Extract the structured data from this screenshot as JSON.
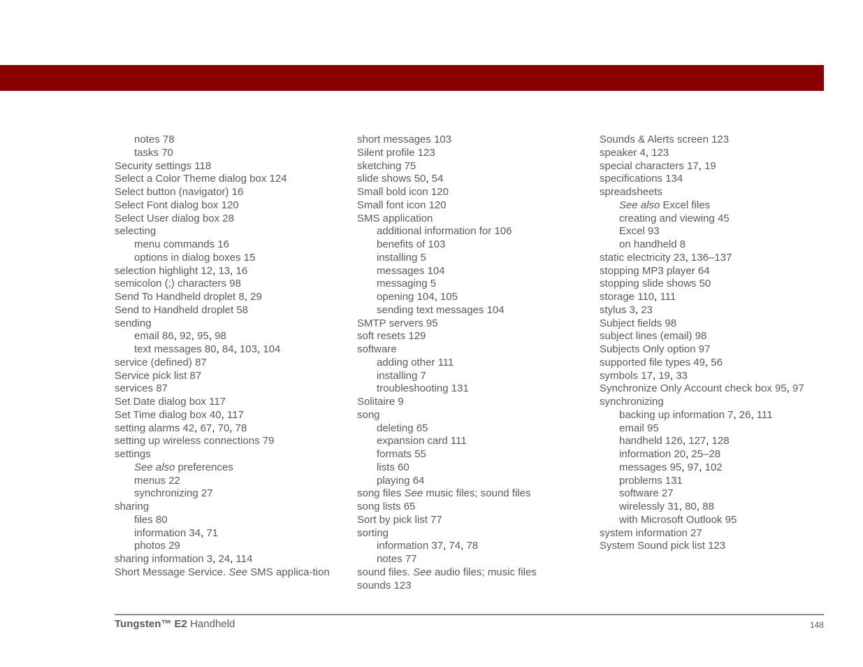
{
  "header": {
    "bar_color": "#8a0000"
  },
  "columns": [
    {
      "entries": [
        {
          "level": 1,
          "term": "notes",
          "pages": [
            "78"
          ]
        },
        {
          "level": 1,
          "term": "tasks",
          "pages": [
            "70"
          ]
        },
        {
          "level": 0,
          "term": "Security settings",
          "pages": [
            "118"
          ]
        },
        {
          "level": 0,
          "term": "Select a Color Theme dialog box",
          "pages": [
            "124"
          ]
        },
        {
          "level": 0,
          "term": "Select button (navigator)",
          "pages": [
            "16"
          ]
        },
        {
          "level": 0,
          "term": "Select Font dialog box",
          "pages": [
            "120"
          ]
        },
        {
          "level": 0,
          "term": "Select User dialog box",
          "pages": [
            "28"
          ]
        },
        {
          "level": 0,
          "term": "selecting",
          "pages": []
        },
        {
          "level": 1,
          "term": "menu commands",
          "pages": [
            "16"
          ]
        },
        {
          "level": 1,
          "term": "options in dialog boxes",
          "pages": [
            "15"
          ]
        },
        {
          "level": 0,
          "term": "selection highlight",
          "pages": [
            "12",
            "13",
            "16"
          ]
        },
        {
          "level": 0,
          "term": "semicolon (;) characters",
          "pages": [
            "98"
          ]
        },
        {
          "level": 0,
          "term": "Send To Handheld droplet",
          "pages": [
            "8",
            "29"
          ]
        },
        {
          "level": 0,
          "term": "Send to Handheld droplet",
          "pages": [
            "58"
          ]
        },
        {
          "level": 0,
          "term": "sending",
          "pages": []
        },
        {
          "level": 1,
          "term": "email",
          "pages": [
            "86",
            "92",
            "95",
            "98"
          ]
        },
        {
          "level": 1,
          "term": "text messages",
          "pages": [
            "80",
            "84",
            "103",
            "104"
          ]
        },
        {
          "level": 0,
          "term": "service (defined)",
          "pages": [
            "87"
          ]
        },
        {
          "level": 0,
          "term": "Service pick list",
          "pages": [
            "87"
          ]
        },
        {
          "level": 0,
          "term": "services",
          "pages": [
            "87"
          ]
        },
        {
          "level": 0,
          "term": "Set Date dialog box",
          "pages": [
            "117"
          ]
        },
        {
          "level": 0,
          "term": "Set Time dialog box",
          "pages": [
            "40",
            "117"
          ]
        },
        {
          "level": 0,
          "term": "setting alarms",
          "pages": [
            "42",
            "67",
            "70",
            "78"
          ]
        },
        {
          "level": 0,
          "term": "setting up wireless connections",
          "pages": [
            "79"
          ]
        },
        {
          "level": 0,
          "term": "settings",
          "pages": []
        },
        {
          "level": 1,
          "see_prefix": "See also",
          "term": "preferences",
          "pages": []
        },
        {
          "level": 1,
          "term": "menus",
          "pages": [
            "22"
          ]
        },
        {
          "level": 1,
          "term": "synchronizing",
          "pages": [
            "27"
          ]
        },
        {
          "level": 0,
          "term": "sharing",
          "pages": []
        },
        {
          "level": 1,
          "term": "files",
          "pages": [
            "80"
          ]
        },
        {
          "level": 1,
          "term": "information",
          "pages": [
            "34",
            "71"
          ]
        },
        {
          "level": 1,
          "term": "photos",
          "pages": [
            "29"
          ]
        },
        {
          "level": 0,
          "term": "sharing information",
          "pages": [
            "3",
            "24",
            "114"
          ]
        },
        {
          "level": 0,
          "term": "Short Message Service.",
          "see_infix": "See",
          "see_target": "SMS applica-tion",
          "wrap": true,
          "pages": []
        }
      ]
    },
    {
      "entries": [
        {
          "level": 0,
          "term": "short messages",
          "pages": [
            "103"
          ]
        },
        {
          "level": 0,
          "term": "Silent profile",
          "pages": [
            "123"
          ]
        },
        {
          "level": 0,
          "term": "sketching",
          "pages": [
            "75"
          ]
        },
        {
          "level": 0,
          "term": "slide shows",
          "pages": [
            "50",
            "54"
          ]
        },
        {
          "level": 0,
          "term": "Small bold icon",
          "pages": [
            "120"
          ]
        },
        {
          "level": 0,
          "term": "Small font icon",
          "pages": [
            "120"
          ]
        },
        {
          "level": 0,
          "term": "SMS application",
          "pages": []
        },
        {
          "level": 1,
          "term": "additional information for",
          "pages": [
            "106"
          ]
        },
        {
          "level": 1,
          "term": "benefits of",
          "pages": [
            "103"
          ]
        },
        {
          "level": 1,
          "term": "installing",
          "pages": [
            "5"
          ]
        },
        {
          "level": 1,
          "term": "messages",
          "pages": [
            "104"
          ]
        },
        {
          "level": 1,
          "term": "messaging",
          "pages": [
            "5"
          ]
        },
        {
          "level": 1,
          "term": "opening",
          "pages": [
            "104",
            "105"
          ]
        },
        {
          "level": 1,
          "term": "sending text messages",
          "pages": [
            "104"
          ]
        },
        {
          "level": 0,
          "term": "SMTP servers",
          "pages": [
            "95"
          ]
        },
        {
          "level": 0,
          "term": "soft resets",
          "pages": [
            "129"
          ]
        },
        {
          "level": 0,
          "term": "software",
          "pages": []
        },
        {
          "level": 1,
          "term": "adding other",
          "pages": [
            "111"
          ]
        },
        {
          "level": 1,
          "term": "installing",
          "pages": [
            "7"
          ]
        },
        {
          "level": 1,
          "term": "troubleshooting",
          "pages": [
            "131"
          ]
        },
        {
          "level": 0,
          "term": "Solitaire",
          "pages": [
            "9"
          ]
        },
        {
          "level": 0,
          "term": "song",
          "pages": []
        },
        {
          "level": 1,
          "term": "deleting",
          "pages": [
            "65"
          ]
        },
        {
          "level": 1,
          "term": "expansion card",
          "pages": [
            "111"
          ]
        },
        {
          "level": 1,
          "term": "formats",
          "pages": [
            "55"
          ]
        },
        {
          "level": 1,
          "term": "lists",
          "pages": [
            "60"
          ]
        },
        {
          "level": 1,
          "term": "playing",
          "pages": [
            "64"
          ]
        },
        {
          "level": 0,
          "term": "song files",
          "see_infix": "See",
          "see_target": "music files; sound files",
          "pages": []
        },
        {
          "level": 0,
          "term": "song lists",
          "pages": [
            "65"
          ]
        },
        {
          "level": 0,
          "term": "Sort by pick list",
          "pages": [
            "77"
          ]
        },
        {
          "level": 0,
          "term": "sorting",
          "pages": []
        },
        {
          "level": 1,
          "term": "information",
          "pages": [
            "37",
            "74",
            "78"
          ]
        },
        {
          "level": 1,
          "term": "notes",
          "pages": [
            "77"
          ]
        },
        {
          "level": 0,
          "term": "sound files.",
          "see_infix": "See",
          "see_target": "audio files; music files",
          "pages": []
        },
        {
          "level": 0,
          "term": "sounds",
          "pages": [
            "123"
          ]
        }
      ]
    },
    {
      "entries": [
        {
          "level": 0,
          "term": "Sounds & Alerts screen",
          "pages": [
            "123"
          ]
        },
        {
          "level": 0,
          "term": "speaker",
          "pages": [
            "4",
            "123"
          ]
        },
        {
          "level": 0,
          "term": "special characters",
          "pages": [
            "17",
            "19"
          ]
        },
        {
          "level": 0,
          "term": "specifications",
          "pages": [
            "134"
          ]
        },
        {
          "level": 0,
          "term": "spreadsheets",
          "pages": []
        },
        {
          "level": 1,
          "see_prefix": "See also",
          "term": "Excel files",
          "pages": []
        },
        {
          "level": 1,
          "term": "creating and viewing",
          "pages": [
            "45"
          ]
        },
        {
          "level": 1,
          "term": "Excel",
          "pages": [
            "93"
          ]
        },
        {
          "level": 1,
          "term": "on handheld",
          "pages": [
            "8"
          ]
        },
        {
          "level": 0,
          "term": "static electricity",
          "pages": [
            "23",
            "136–137"
          ]
        },
        {
          "level": 0,
          "term": "stopping MP3 player",
          "pages": [
            "64"
          ]
        },
        {
          "level": 0,
          "term": "stopping slide shows",
          "pages": [
            "50"
          ]
        },
        {
          "level": 0,
          "term": "storage",
          "pages": [
            "110",
            "111"
          ]
        },
        {
          "level": 0,
          "term": "stylus",
          "pages": [
            "3",
            "23"
          ]
        },
        {
          "level": 0,
          "term": "Subject fields",
          "pages": [
            "98"
          ]
        },
        {
          "level": 0,
          "term": "subject lines (email)",
          "pages": [
            "98"
          ]
        },
        {
          "level": 0,
          "term": "Subjects Only option",
          "pages": [
            "97"
          ]
        },
        {
          "level": 0,
          "term": "supported file types",
          "pages": [
            "49",
            "56"
          ]
        },
        {
          "level": 0,
          "term": "symbols",
          "pages": [
            "17",
            "19",
            "33"
          ]
        },
        {
          "level": 0,
          "term": "Synchronize Only Account check box",
          "pages": [
            "95",
            "97"
          ]
        },
        {
          "level": 0,
          "term": "synchronizing",
          "pages": []
        },
        {
          "level": 1,
          "term": "backing up information",
          "pages": [
            "7",
            "26",
            "111"
          ]
        },
        {
          "level": 1,
          "term": "email",
          "pages": [
            "95"
          ]
        },
        {
          "level": 1,
          "term": "handheld",
          "pages": [
            "126",
            "127",
            "128"
          ]
        },
        {
          "level": 1,
          "term": "information",
          "pages": [
            "20",
            "25–28"
          ]
        },
        {
          "level": 1,
          "term": "messages",
          "pages": [
            "95",
            "97",
            "102"
          ]
        },
        {
          "level": 1,
          "term": "problems",
          "pages": [
            "131"
          ]
        },
        {
          "level": 1,
          "term": "software",
          "pages": [
            "27"
          ]
        },
        {
          "level": 1,
          "term": "wirelessly",
          "pages": [
            "31",
            "80",
            "88"
          ]
        },
        {
          "level": 1,
          "term": "with Microsoft Outlook",
          "pages": [
            "95"
          ]
        },
        {
          "level": 0,
          "term": "system information",
          "pages": [
            "27"
          ]
        },
        {
          "level": 0,
          "term": "System Sound pick list",
          "pages": [
            "123"
          ]
        }
      ]
    }
  ],
  "footer": {
    "product_name": "Tungsten™ E2",
    "product_suffix": "Handheld",
    "page_number": "148"
  }
}
